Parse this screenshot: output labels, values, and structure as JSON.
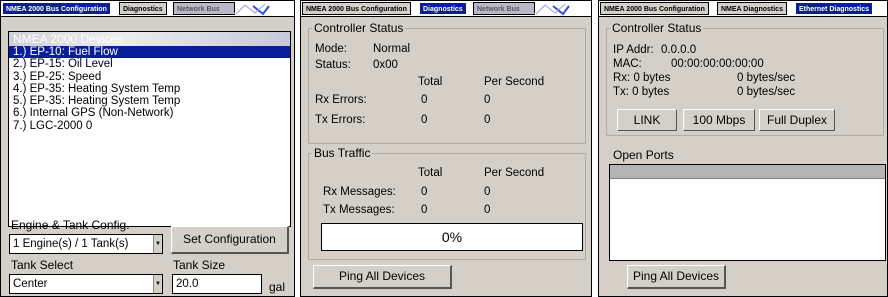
{
  "colors": {
    "selection": "#0a1e99",
    "panel_bg": "#d4d0c8"
  },
  "panel1": {
    "tabs": [
      "NMEA 2000 Bus Configuration",
      "Diagnostics",
      "Network Bus"
    ],
    "active_tab": "NMEA 2000 Bus Configuration",
    "devices_header": "NMEA 2000 Devices",
    "devices": [
      "1.) EP-10: Fuel Flow",
      "2.) EP-15: Oil Level",
      "3.) EP-25: Speed",
      "4.) EP-35: Heating System Temp",
      "5.) EP-35: Heating System Temp",
      "6.) Internal GPS (Non-Network)",
      "7.) LGC-2000 0"
    ],
    "engine_label": "Engine & Tank Config.",
    "engine_value": "1 Engine(s) / 1 Tank(s)",
    "set_config_button": "Set Configuration",
    "tank_select_label": "Tank Select",
    "tank_select_value": "Center",
    "tank_size_label": "Tank Size",
    "tank_size_value": "20.0",
    "tank_size_unit": "gal"
  },
  "panel2": {
    "tabs": [
      "NMEA 2000 Bus Configuration",
      "Diagnostics",
      "Network Bus"
    ],
    "active_tab": "Diagnostics",
    "controller_title": "Controller Status",
    "mode_label": "Mode:",
    "mode_value": "Normal",
    "status_label": "Status:",
    "status_value": "0x00",
    "col_total": "Total",
    "col_per_second": "Per Second",
    "rx_errors_label": "Rx Errors:",
    "rx_errors_total": "0",
    "rx_errors_ps": "0",
    "tx_errors_label": "Tx Errors:",
    "tx_errors_total": "0",
    "tx_errors_ps": "0",
    "bus_title": "Bus Traffic",
    "rx_msgs_label": "Rx Messages:",
    "rx_msgs_total": "0",
    "rx_msgs_ps": "0",
    "tx_msgs_label": "Tx Messages:",
    "tx_msgs_total": "0",
    "tx_msgs_ps": "0",
    "progress_text": "0%",
    "progress_fraction": 0,
    "ping_button": "Ping All Devices"
  },
  "panel3": {
    "tabs": [
      "NMEA 2000 Bus Configuration",
      "NMEA Diagnostics",
      "Ethernet Diagnostics"
    ],
    "active_tab": "Ethernet Diagnostics",
    "controller_title": "Controller Status",
    "ip_label": "IP Addr:",
    "ip_value": "0.0.0.0",
    "mac_label": "MAC:",
    "mac_value": "00:00:00:00:00:00",
    "rx_text": "Rx: 0 bytes",
    "rx_rate": "0 bytes/sec",
    "tx_text": "Tx: 0 bytes",
    "tx_rate": "0 bytes/sec",
    "link_label": "LINK",
    "speed_label": "100 Mbps",
    "duplex_label": "Full Duplex",
    "open_ports_title": "Open Ports",
    "ping_button": "Ping All Devices"
  }
}
